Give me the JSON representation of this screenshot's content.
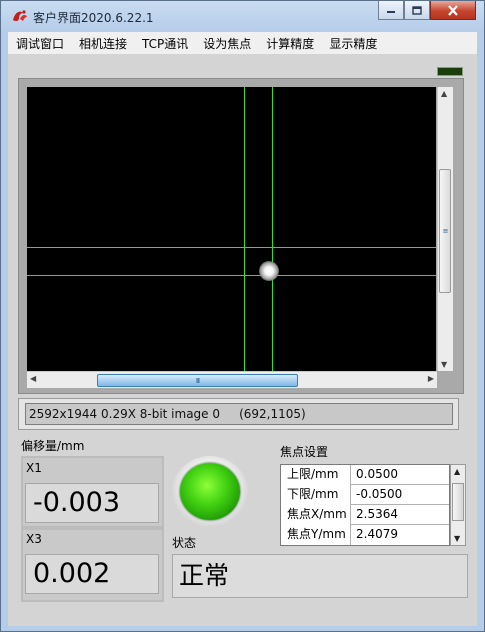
{
  "window": {
    "title": "客户界面2020.6.22.1"
  },
  "menu": {
    "items": [
      "调试窗口",
      "相机连接",
      "TCP通讯",
      "设为焦点",
      "计算精度",
      "显示精度"
    ]
  },
  "image_display": {
    "status_line": "2592x1944 0.29X 8-bit image 0     (692,1105)",
    "hscroll_grip": "III",
    "vscroll_grip": "≡"
  },
  "offset": {
    "section_label": "偏移量/mm",
    "x1_label": "X1",
    "x1_value": "-0.003",
    "x3_label": "X3",
    "x3_value": "0.002"
  },
  "status": {
    "label": "状态",
    "value": "正常",
    "led_color": "#43d212"
  },
  "focus_settings": {
    "title": "焦点设置",
    "rows": [
      {
        "key": "上限/mm",
        "value": "0.0500"
      },
      {
        "key": "下限/mm",
        "value": "-0.0500"
      },
      {
        "key": "焦点X/mm",
        "value": "2.5364"
      },
      {
        "key": "焦点Y/mm",
        "value": "2.4079"
      }
    ]
  },
  "colors": {
    "crosshair": "#2fe02f",
    "display_background": "#000000"
  },
  "icons": {
    "app": "app-logo-icon",
    "minimize": "minimize-icon",
    "maximize": "maximize-icon",
    "close": "close-icon"
  }
}
